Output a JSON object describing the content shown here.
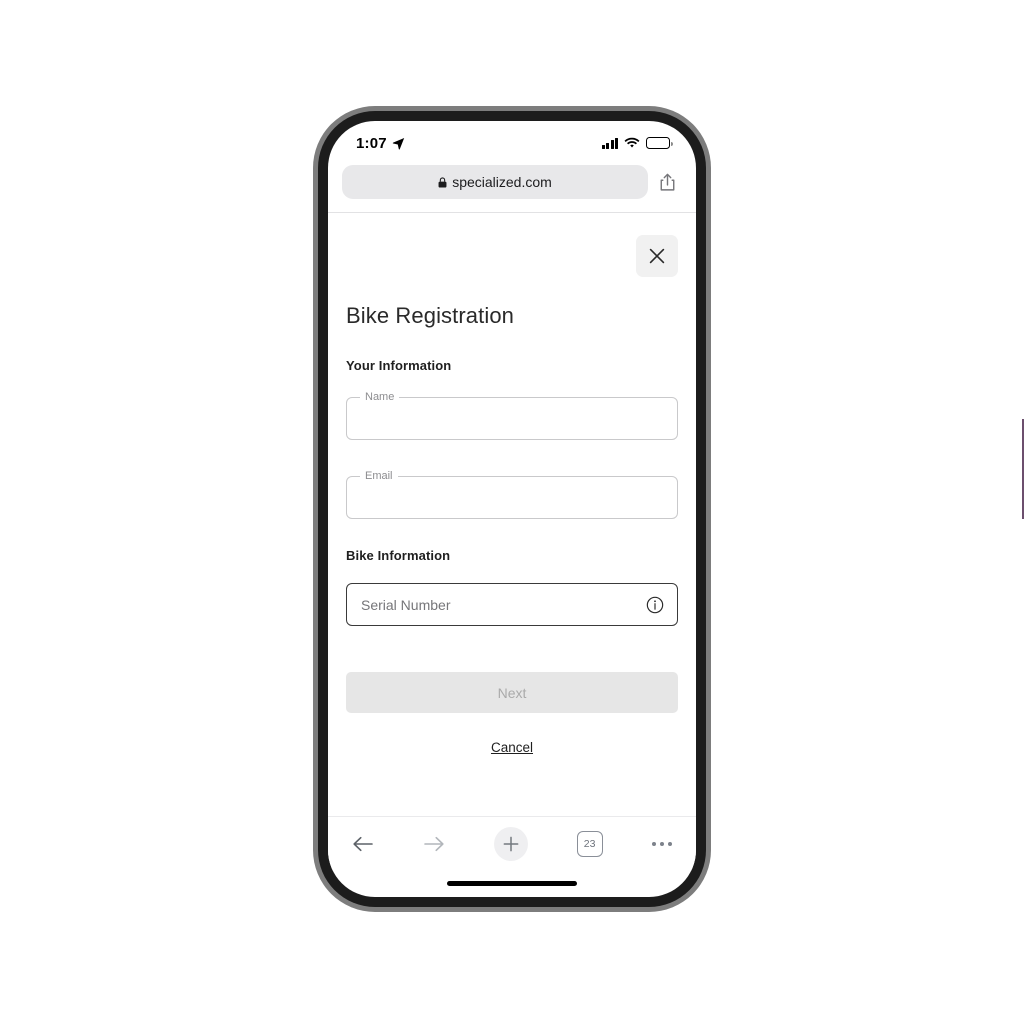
{
  "status_bar": {
    "time": "1:07",
    "location_icon": "location-arrow-icon",
    "signal_icon": "cellular-signal-icon",
    "wifi_icon": "wifi-icon",
    "battery_icon": "battery-full-icon"
  },
  "browser": {
    "url": "specialized.com",
    "lock_icon": "lock-icon",
    "share_icon": "share-icon",
    "toolbar": {
      "back_icon": "back-arrow-icon",
      "forward_icon": "forward-arrow-icon",
      "new_tab_icon": "plus-icon",
      "tabs_count": "23",
      "more_icon": "ellipsis-icon"
    }
  },
  "page": {
    "close_icon": "close-x-icon",
    "title": "Bike Registration",
    "sections": [
      {
        "heading": "Your Information",
        "fields": [
          {
            "label": "Name",
            "value": "",
            "placeholder": ""
          },
          {
            "label": "Email",
            "value": "",
            "placeholder": ""
          }
        ]
      },
      {
        "heading": "Bike Information",
        "fields": [
          {
            "label": "Serial Number",
            "value": "",
            "placeholder": "Serial Number",
            "info_icon": "info-circle-icon"
          }
        ]
      }
    ],
    "next_label": "Next",
    "cancel_label": "Cancel"
  },
  "colors": {
    "disabled_button_bg": "#e6e6e6",
    "disabled_button_text": "#aaaaaa",
    "url_bar_bg": "#e8e8ea",
    "field_border": "#c9c9cb",
    "active_field_border": "#3a3a3a",
    "phone_side_button": "#6c4f6e"
  }
}
